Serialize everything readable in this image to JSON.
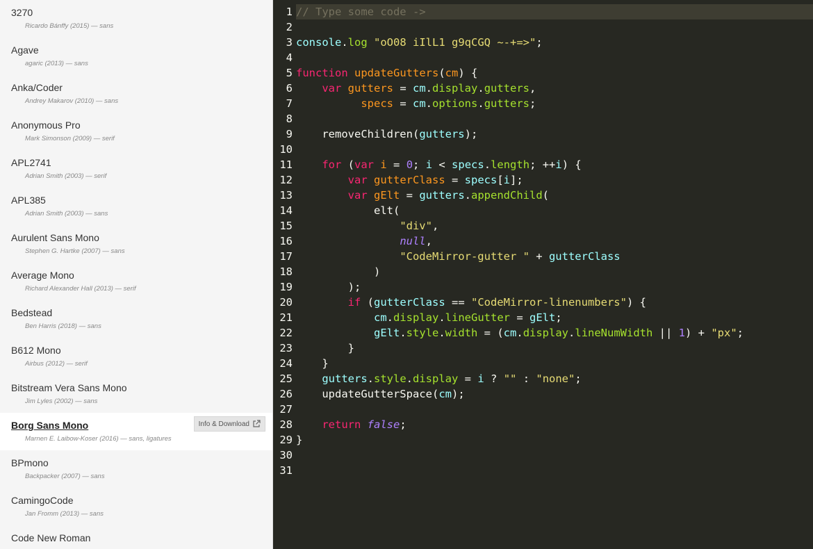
{
  "sidebar": {
    "fonts": [
      {
        "name": "3270",
        "meta": "Ricardo Bánffy (2015) — sans"
      },
      {
        "name": "Agave",
        "meta": "agaric (2013) — sans"
      },
      {
        "name": "Anka/Coder",
        "meta": "Andrey Makarov (2010) — sans"
      },
      {
        "name": "Anonymous Pro",
        "meta": "Mark Simonson (2009) — serif"
      },
      {
        "name": "APL2741",
        "meta": "Adrian Smith (2003) — serif"
      },
      {
        "name": "APL385",
        "meta": "Adrian Smith (2003) — sans"
      },
      {
        "name": "Aurulent Sans Mono",
        "meta": "Stephen G. Hartke (2007) — sans"
      },
      {
        "name": "Average Mono",
        "meta": "Richard Alexander Hall (2013) — serif"
      },
      {
        "name": "Bedstead",
        "meta": "Ben Harris (2018) — sans"
      },
      {
        "name": "B612 Mono",
        "meta": "Airbus (2012) — serif"
      },
      {
        "name": "Bitstream Vera Sans Mono",
        "meta": "Jim Lyles (2002) — sans"
      },
      {
        "name": "Borg Sans Mono",
        "meta": "Marnen E. Laibow-Koser (2016) — sans, ligatures",
        "selected": true
      },
      {
        "name": "BPmono",
        "meta": "Backpacker (2007) — sans"
      },
      {
        "name": "CamingoCode",
        "meta": "Jan Fromm (2013) — sans"
      },
      {
        "name": "Code New Roman",
        "meta": ""
      }
    ],
    "info_button_label": "Info & Download",
    "info_button_icon": "external-link-icon"
  },
  "editor": {
    "active_line": 1,
    "lines": [
      [
        {
          "t": "comment",
          "v": "// Type some code ->"
        }
      ],
      [],
      [
        {
          "t": "var2",
          "v": "console"
        },
        {
          "t": "plain",
          "v": "."
        },
        {
          "t": "prop",
          "v": "log"
        },
        {
          "t": "plain",
          "v": " "
        },
        {
          "t": "str",
          "v": "\"oO08 iIlL1 g9qCGQ ~-+=>\""
        },
        {
          "t": "plain",
          "v": ";"
        }
      ],
      [],
      [
        {
          "t": "keyword",
          "v": "function"
        },
        {
          "t": "plain",
          "v": " "
        },
        {
          "t": "def",
          "v": "updateGutters"
        },
        {
          "t": "plain",
          "v": "("
        },
        {
          "t": "def",
          "v": "cm"
        },
        {
          "t": "plain",
          "v": ") {"
        }
      ],
      [
        {
          "t": "plain",
          "v": "    "
        },
        {
          "t": "keyword",
          "v": "var"
        },
        {
          "t": "plain",
          "v": " "
        },
        {
          "t": "def",
          "v": "gutters"
        },
        {
          "t": "plain",
          "v": " = "
        },
        {
          "t": "var2",
          "v": "cm"
        },
        {
          "t": "plain",
          "v": "."
        },
        {
          "t": "prop",
          "v": "display"
        },
        {
          "t": "plain",
          "v": "."
        },
        {
          "t": "prop",
          "v": "gutters"
        },
        {
          "t": "plain",
          "v": ","
        }
      ],
      [
        {
          "t": "plain",
          "v": "          "
        },
        {
          "t": "def",
          "v": "specs"
        },
        {
          "t": "plain",
          "v": " = "
        },
        {
          "t": "var2",
          "v": "cm"
        },
        {
          "t": "plain",
          "v": "."
        },
        {
          "t": "prop",
          "v": "options"
        },
        {
          "t": "plain",
          "v": "."
        },
        {
          "t": "prop",
          "v": "gutters"
        },
        {
          "t": "plain",
          "v": ";"
        }
      ],
      [],
      [
        {
          "t": "plain",
          "v": "    removeChildren("
        },
        {
          "t": "var2",
          "v": "gutters"
        },
        {
          "t": "plain",
          "v": ");"
        }
      ],
      [],
      [
        {
          "t": "plain",
          "v": "    "
        },
        {
          "t": "keyword",
          "v": "for"
        },
        {
          "t": "plain",
          "v": " ("
        },
        {
          "t": "keyword",
          "v": "var"
        },
        {
          "t": "plain",
          "v": " "
        },
        {
          "t": "def",
          "v": "i"
        },
        {
          "t": "plain",
          "v": " = "
        },
        {
          "t": "num",
          "v": "0"
        },
        {
          "t": "plain",
          "v": "; "
        },
        {
          "t": "var2",
          "v": "i"
        },
        {
          "t": "plain",
          "v": " < "
        },
        {
          "t": "var2",
          "v": "specs"
        },
        {
          "t": "plain",
          "v": "."
        },
        {
          "t": "prop",
          "v": "length"
        },
        {
          "t": "plain",
          "v": "; ++"
        },
        {
          "t": "var2",
          "v": "i"
        },
        {
          "t": "plain",
          "v": ") {"
        }
      ],
      [
        {
          "t": "plain",
          "v": "        "
        },
        {
          "t": "keyword",
          "v": "var"
        },
        {
          "t": "plain",
          "v": " "
        },
        {
          "t": "def",
          "v": "gutterClass"
        },
        {
          "t": "plain",
          "v": " = "
        },
        {
          "t": "var2",
          "v": "specs"
        },
        {
          "t": "plain",
          "v": "["
        },
        {
          "t": "var2",
          "v": "i"
        },
        {
          "t": "plain",
          "v": "];"
        }
      ],
      [
        {
          "t": "plain",
          "v": "        "
        },
        {
          "t": "keyword",
          "v": "var"
        },
        {
          "t": "plain",
          "v": " "
        },
        {
          "t": "def",
          "v": "gElt"
        },
        {
          "t": "plain",
          "v": " = "
        },
        {
          "t": "var2",
          "v": "gutters"
        },
        {
          "t": "plain",
          "v": "."
        },
        {
          "t": "prop",
          "v": "appendChild"
        },
        {
          "t": "plain",
          "v": "("
        }
      ],
      [
        {
          "t": "plain",
          "v": "            elt("
        }
      ],
      [
        {
          "t": "plain",
          "v": "                "
        },
        {
          "t": "str",
          "v": "\"div\""
        },
        {
          "t": "plain",
          "v": ","
        }
      ],
      [
        {
          "t": "plain",
          "v": "                "
        },
        {
          "t": "atom",
          "v": "null"
        },
        {
          "t": "plain",
          "v": ","
        }
      ],
      [
        {
          "t": "plain",
          "v": "                "
        },
        {
          "t": "str",
          "v": "\"CodeMirror-gutter \""
        },
        {
          "t": "plain",
          "v": " + "
        },
        {
          "t": "var2",
          "v": "gutterClass"
        }
      ],
      [
        {
          "t": "plain",
          "v": "            )"
        }
      ],
      [
        {
          "t": "plain",
          "v": "        );"
        }
      ],
      [
        {
          "t": "plain",
          "v": "        "
        },
        {
          "t": "keyword",
          "v": "if"
        },
        {
          "t": "plain",
          "v": " ("
        },
        {
          "t": "var2",
          "v": "gutterClass"
        },
        {
          "t": "plain",
          "v": " == "
        },
        {
          "t": "str",
          "v": "\"CodeMirror-linenumbers\""
        },
        {
          "t": "plain",
          "v": ") {"
        }
      ],
      [
        {
          "t": "plain",
          "v": "            "
        },
        {
          "t": "var2",
          "v": "cm"
        },
        {
          "t": "plain",
          "v": "."
        },
        {
          "t": "prop",
          "v": "display"
        },
        {
          "t": "plain",
          "v": "."
        },
        {
          "t": "prop",
          "v": "lineGutter"
        },
        {
          "t": "plain",
          "v": " = "
        },
        {
          "t": "var2",
          "v": "gElt"
        },
        {
          "t": "plain",
          "v": ";"
        }
      ],
      [
        {
          "t": "plain",
          "v": "            "
        },
        {
          "t": "var2",
          "v": "gElt"
        },
        {
          "t": "plain",
          "v": "."
        },
        {
          "t": "prop",
          "v": "style"
        },
        {
          "t": "plain",
          "v": "."
        },
        {
          "t": "prop",
          "v": "width"
        },
        {
          "t": "plain",
          "v": " = ("
        },
        {
          "t": "var2",
          "v": "cm"
        },
        {
          "t": "plain",
          "v": "."
        },
        {
          "t": "prop",
          "v": "display"
        },
        {
          "t": "plain",
          "v": "."
        },
        {
          "t": "prop",
          "v": "lineNumWidth"
        },
        {
          "t": "plain",
          "v": " || "
        },
        {
          "t": "num",
          "v": "1"
        },
        {
          "t": "plain",
          "v": ") + "
        },
        {
          "t": "str",
          "v": "\"px\""
        },
        {
          "t": "plain",
          "v": ";"
        }
      ],
      [
        {
          "t": "plain",
          "v": "        }"
        }
      ],
      [
        {
          "t": "plain",
          "v": "    }"
        }
      ],
      [
        {
          "t": "plain",
          "v": "    "
        },
        {
          "t": "var2",
          "v": "gutters"
        },
        {
          "t": "plain",
          "v": "."
        },
        {
          "t": "prop",
          "v": "style"
        },
        {
          "t": "plain",
          "v": "."
        },
        {
          "t": "prop",
          "v": "display"
        },
        {
          "t": "plain",
          "v": " = "
        },
        {
          "t": "var2",
          "v": "i"
        },
        {
          "t": "plain",
          "v": " ? "
        },
        {
          "t": "str",
          "v": "\"\""
        },
        {
          "t": "plain",
          "v": " : "
        },
        {
          "t": "str",
          "v": "\"none\""
        },
        {
          "t": "plain",
          "v": ";"
        }
      ],
      [
        {
          "t": "plain",
          "v": "    updateGutterSpace("
        },
        {
          "t": "var2",
          "v": "cm"
        },
        {
          "t": "plain",
          "v": ");"
        }
      ],
      [],
      [
        {
          "t": "plain",
          "v": "    "
        },
        {
          "t": "keyword",
          "v": "return"
        },
        {
          "t": "plain",
          "v": " "
        },
        {
          "t": "atom",
          "v": "false"
        },
        {
          "t": "plain",
          "v": ";"
        }
      ],
      [
        {
          "t": "plain",
          "v": "}"
        }
      ],
      [],
      []
    ]
  },
  "colors": {
    "editor_bg": "#272822",
    "sidebar_bg": "#f5f5f5",
    "selected_bg": "#ffffff",
    "keyword": "#f92672",
    "string": "#e6db74",
    "number": "#ae81ff",
    "comment": "#75715e",
    "property": "#a6e22e",
    "variable": "#9effff",
    "definition": "#fd971f"
  }
}
